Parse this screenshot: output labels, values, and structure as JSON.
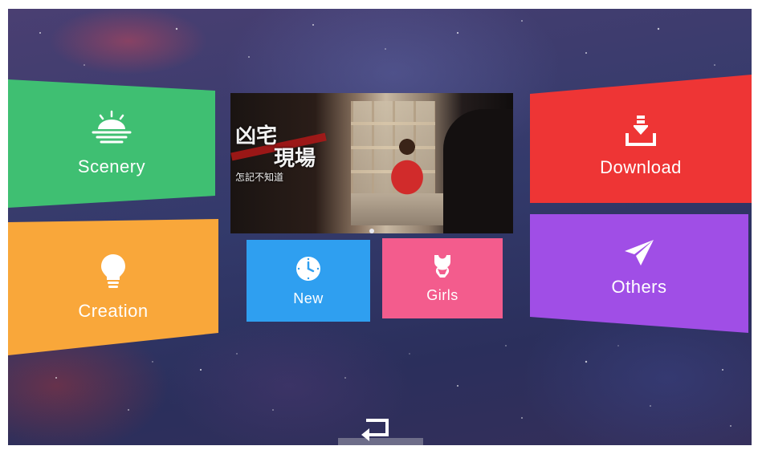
{
  "tiles": {
    "scenery": {
      "label": "Scenery",
      "icon": "sun-horizon-icon",
      "color": "#3fbf72"
    },
    "creation": {
      "label": "Creation",
      "icon": "lightbulb-icon",
      "color": "#f9a73a"
    },
    "new": {
      "label": "New",
      "icon": "clock-icon",
      "color": "#2f9ff0"
    },
    "girls": {
      "label": "Girls",
      "icon": "swimsuit-icon",
      "color": "#f35c8d"
    },
    "download": {
      "label": "Download",
      "icon": "download-icon",
      "color": "#ee3535"
    },
    "others": {
      "label": "Others",
      "icon": "paper-plane-icon",
      "color": "#a04ee6"
    }
  },
  "banner": {
    "title_line1": "凶宅",
    "title_line2": "現場",
    "title_line3": "怎記不知道"
  },
  "navigation": {
    "back_icon": "return-arrow-icon"
  }
}
